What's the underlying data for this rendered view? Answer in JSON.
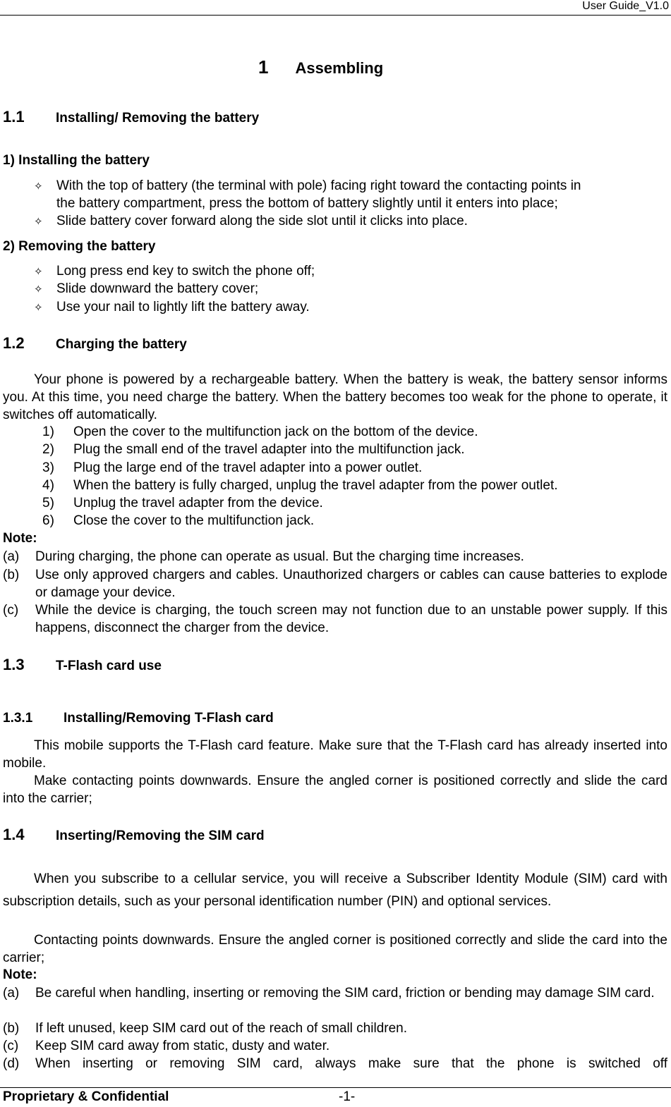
{
  "header": {
    "title": "User  Guide_V1.0"
  },
  "chapter": {
    "number": "1",
    "title": "Assembling"
  },
  "sections": {
    "s1_1": {
      "number": "1.1",
      "title": "Installing/ Removing the battery"
    },
    "install": {
      "heading": "1)  Installing the battery",
      "bullets": [
        "With the top of battery (the terminal with pole) facing right toward the contacting points in",
        "the battery compartment, press the bottom of battery slightly until it enters into place;",
        "Slide battery cover forward along the side slot until it clicks into place."
      ]
    },
    "remove": {
      "heading": "2)  Removing the battery",
      "bullets": [
        "Long press end key to switch the phone off;",
        "Slide downward the battery cover;",
        "Use your nail to lightly lift the battery away."
      ]
    },
    "s1_2": {
      "number": "1.2",
      "title": "Charging the battery",
      "paragraph": "Your phone is powered by a rechargeable battery. When the battery is weak, the battery sensor informs you. At this time, you need charge the battery. When the battery becomes too weak for the phone to operate, it switches off automatically.",
      "steps": [
        {
          "n": "1)",
          "text": "Open the cover to the multifunction jack on the bottom of the device."
        },
        {
          "n": "2)",
          "text": "Plug the small end of the travel adapter into the multifunction jack."
        },
        {
          "n": "3)",
          "text": "Plug the large end of the travel adapter into a power outlet."
        },
        {
          "n": "4)",
          "text": "When the battery is fully charged, unplug the travel adapter from the power outlet."
        },
        {
          "n": "5)",
          "text": "Unplug the travel adapter from the device."
        },
        {
          "n": "6)",
          "text": "Close the cover to the multifunction jack."
        }
      ],
      "note_label": "Note:",
      "notes": [
        {
          "n": "(a)",
          "text": "During charging, the phone can operate as usual. But the charging time increases."
        },
        {
          "n": "(b)",
          "text": "Use only approved chargers and cables. Unauthorized chargers or cables can cause batteries to explode or damage your device."
        },
        {
          "n": "(c)",
          "text": "While the device is charging, the touch screen may not function due to an unstable power supply. If this happens, disconnect the charger from the device."
        }
      ]
    },
    "s1_3": {
      "number": "1.3",
      "title": "T-Flash card use"
    },
    "s1_3_1": {
      "number": "1.3.1",
      "title": "Installing/Removing T-Flash card",
      "paragraphs": [
        "This mobile supports the T-Flash card feature. Make sure that the T-Flash card has already inserted into mobile.",
        "Make contacting points downwards. Ensure the angled corner is positioned correctly and slide the card into the carrier;"
      ]
    },
    "s1_4": {
      "number": "1.4",
      "title": "Inserting/Removing the SIM card",
      "paragraphs": [
        "When you subscribe to a cellular service, you will receive a Subscriber Identity Module (SIM) card with subscription details, such as your personal identification number (PIN) and optional services.",
        "Contacting points downwards. Ensure the angled corner is positioned correctly and slide the card into the carrier;"
      ],
      "note_label": "Note:",
      "notes": [
        {
          "n": "(a)",
          "text": "Be careful when handling, inserting or removing the SIM card, friction or bending may damage SIM card."
        },
        {
          "n": "(b)",
          "text": "If left unused, keep SIM card out of the reach of small children."
        },
        {
          "n": "(c)",
          "text": "Keep SIM card away from static, dusty and water."
        },
        {
          "n": "(d)",
          "text": "When inserting or removing SIM card, always make sure that the phone is switched off"
        }
      ]
    }
  },
  "bullet_icon": "diamond-outline-star-icon",
  "bullet_glyph": "✧",
  "footer": {
    "left": "Proprietary & Confidential",
    "page": "-1-"
  }
}
